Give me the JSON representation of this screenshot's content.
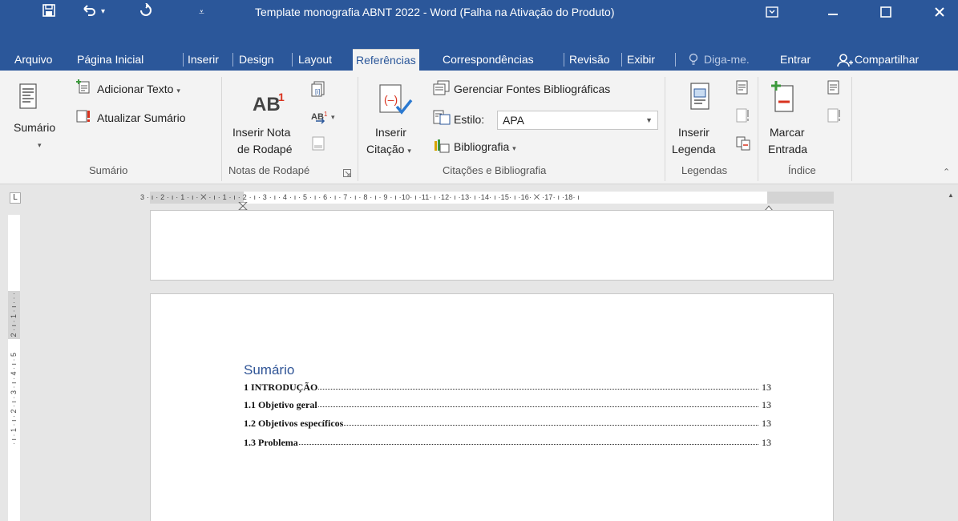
{
  "titlebar": {
    "title": "Template monografia ABNT 2022 - Word (Falha na Ativação do Produto)",
    "save_icon": "save-icon",
    "undo_icon": "undo-icon",
    "redo_icon": "redo-icon",
    "customize_icon": "customize-qat-icon",
    "ribbon_display_icon": "ribbon-display-options-icon",
    "minimize_icon": "minimize-icon",
    "maximize_icon": "maximize-icon",
    "close_icon": "close-icon",
    "accent": "#2b579a"
  },
  "tabs": [
    {
      "label": "Arquivo"
    },
    {
      "label": "Página Inicial"
    },
    {
      "label": "Inserir"
    },
    {
      "label": "Design"
    },
    {
      "label": "Layout"
    },
    {
      "label": "Referências",
      "active": true
    },
    {
      "label": "Correspondências"
    },
    {
      "label": "Revisão"
    },
    {
      "label": "Exibir"
    }
  ],
  "tell_me": "Diga-me.",
  "sign_in": "Entrar",
  "share": "Compartilhar",
  "ribbon": {
    "sumario": {
      "big_button": "Sumário",
      "add_text": "Adicionar Texto",
      "update": "Atualizar Sumário",
      "group_label": "Sumário"
    },
    "notas": {
      "insert_footnote_line1": "Inserir Nota",
      "insert_footnote_line2": "de Rodapé",
      "group_label": "Notas de Rodapé"
    },
    "citacoes": {
      "insert_citation_line1": "Inserir",
      "insert_citation_line2": "Citação",
      "manage_sources": "Gerenciar Fontes Bibliográficas",
      "style_label": "Estilo:",
      "style_value": "APA",
      "bibliography": "Bibliografia",
      "group_label": "Citações e Bibliografia"
    },
    "legendas": {
      "insert_caption_line1": "Inserir",
      "insert_caption_line2": "Legenda",
      "group_label": "Legendas"
    },
    "indice": {
      "mark_entry_line1": "Marcar",
      "mark_entry_line2": "Entrada",
      "group_label": "Índice"
    }
  },
  "ruler": {
    "horizontal": "3 · ı · 2 · ı · 1 · ı · ⨉ · ı · 1 · ı · 2 · ı · 3 · ı · 4 · ı · 5 · ı · 6 · ı · 7 · ı · 8 · ı · 9 · ı ·10· ı ·11· ı ·12· ı ·13· ı ·14· ı ·15· ı ·16· ⨉ ·17· ı ·18· ı",
    "tab_selector": "L"
  },
  "document": {
    "toc_title": "Sumário",
    "toc": [
      {
        "text": "1 INTRODUÇÃO",
        "page": "13"
      },
      {
        "text": "1.1 Objetivo geral",
        "page": "13"
      },
      {
        "text": "1.2 Objetivos específicos",
        "page": "13"
      },
      {
        "text": "1.3 Problema",
        "page": "13"
      }
    ]
  }
}
